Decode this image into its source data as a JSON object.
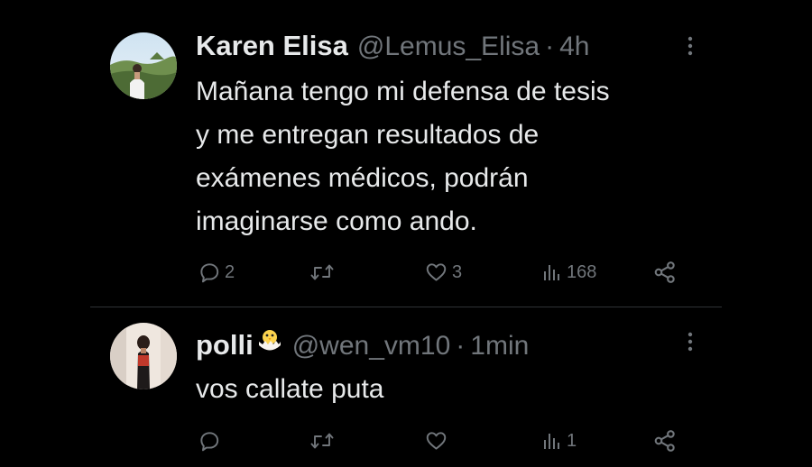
{
  "colors": {
    "background": "#000000",
    "text_primary": "#e7e9ea",
    "text_secondary": "#71767b",
    "divider": "#2f3336"
  },
  "tweets": [
    {
      "display_name": "Karen Elisa",
      "handle": "@Lemus_Elisa",
      "separator": "·",
      "time": "4h",
      "text": "Mañana tengo mi defensa de tesis\ny me entregan resultados de\nexámenes médicos, podrán\nimaginarse como ando.",
      "avatar_icon": "profile-photo-landscape",
      "actions": {
        "reply_icon": "reply-icon",
        "reply_count": "2",
        "retweet_icon": "retweet-icon",
        "retweet_count": "",
        "like_icon": "heart-icon",
        "like_count": "3",
        "views_icon": "views-icon",
        "views_count": "168",
        "share_icon": "share-icon"
      }
    },
    {
      "display_name": "polli",
      "name_emoji": "hatching-chick-emoji",
      "handle": "@wen_vm10",
      "separator": "·",
      "time": "1min",
      "text": "vos callate puta",
      "avatar_icon": "profile-photo-person",
      "actions": {
        "reply_icon": "reply-icon",
        "reply_count": "",
        "retweet_icon": "retweet-icon",
        "retweet_count": "",
        "like_icon": "heart-icon",
        "like_count": "",
        "views_icon": "views-icon",
        "views_count": "1",
        "share_icon": "share-icon"
      }
    }
  ]
}
